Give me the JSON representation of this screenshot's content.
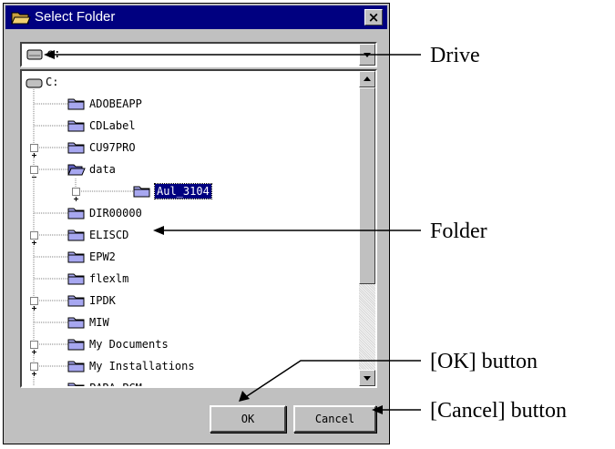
{
  "window": {
    "title": "Select Folder",
    "close_label": "×"
  },
  "drive": {
    "value": "c:"
  },
  "tree": {
    "root": "C:",
    "items": [
      {
        "label": "ADOBEAPP",
        "expander": "none",
        "open": false,
        "selected": false
      },
      {
        "label": "CDLabel",
        "expander": "none",
        "open": false,
        "selected": false
      },
      {
        "label": "CU97PRO",
        "expander": "plus",
        "open": false,
        "selected": false
      },
      {
        "label": "data",
        "expander": "minus",
        "open": true,
        "selected": false
      },
      {
        "label": "Aul_3104",
        "expander": "plus",
        "open": false,
        "selected": true,
        "child": true
      },
      {
        "label": "DIR00000",
        "expander": "none",
        "open": false,
        "selected": false
      },
      {
        "label": "ELISCD",
        "expander": "plus",
        "open": false,
        "selected": false
      },
      {
        "label": "EPW2",
        "expander": "none",
        "open": false,
        "selected": false
      },
      {
        "label": "flexlm",
        "expander": "none",
        "open": false,
        "selected": false
      },
      {
        "label": "IPDK",
        "expander": "plus",
        "open": false,
        "selected": false
      },
      {
        "label": "MIW",
        "expander": "none",
        "open": false,
        "selected": false
      },
      {
        "label": "My Documents",
        "expander": "plus",
        "open": false,
        "selected": false
      },
      {
        "label": "My Installations",
        "expander": "plus",
        "open": false,
        "selected": false
      },
      {
        "label": "PARA_PCM",
        "expander": "none",
        "open": false,
        "selected": false
      }
    ]
  },
  "buttons": {
    "ok": "OK",
    "cancel": "Cancel"
  },
  "callouts": {
    "drive": "Drive",
    "folder": "Folder",
    "ok": "[OK] button",
    "cancel": "[Cancel] button"
  },
  "colors": {
    "titlebar": "#000080",
    "dialog": "#c0c0c0",
    "folder": "#a7a7f0",
    "selection": "#000080"
  }
}
